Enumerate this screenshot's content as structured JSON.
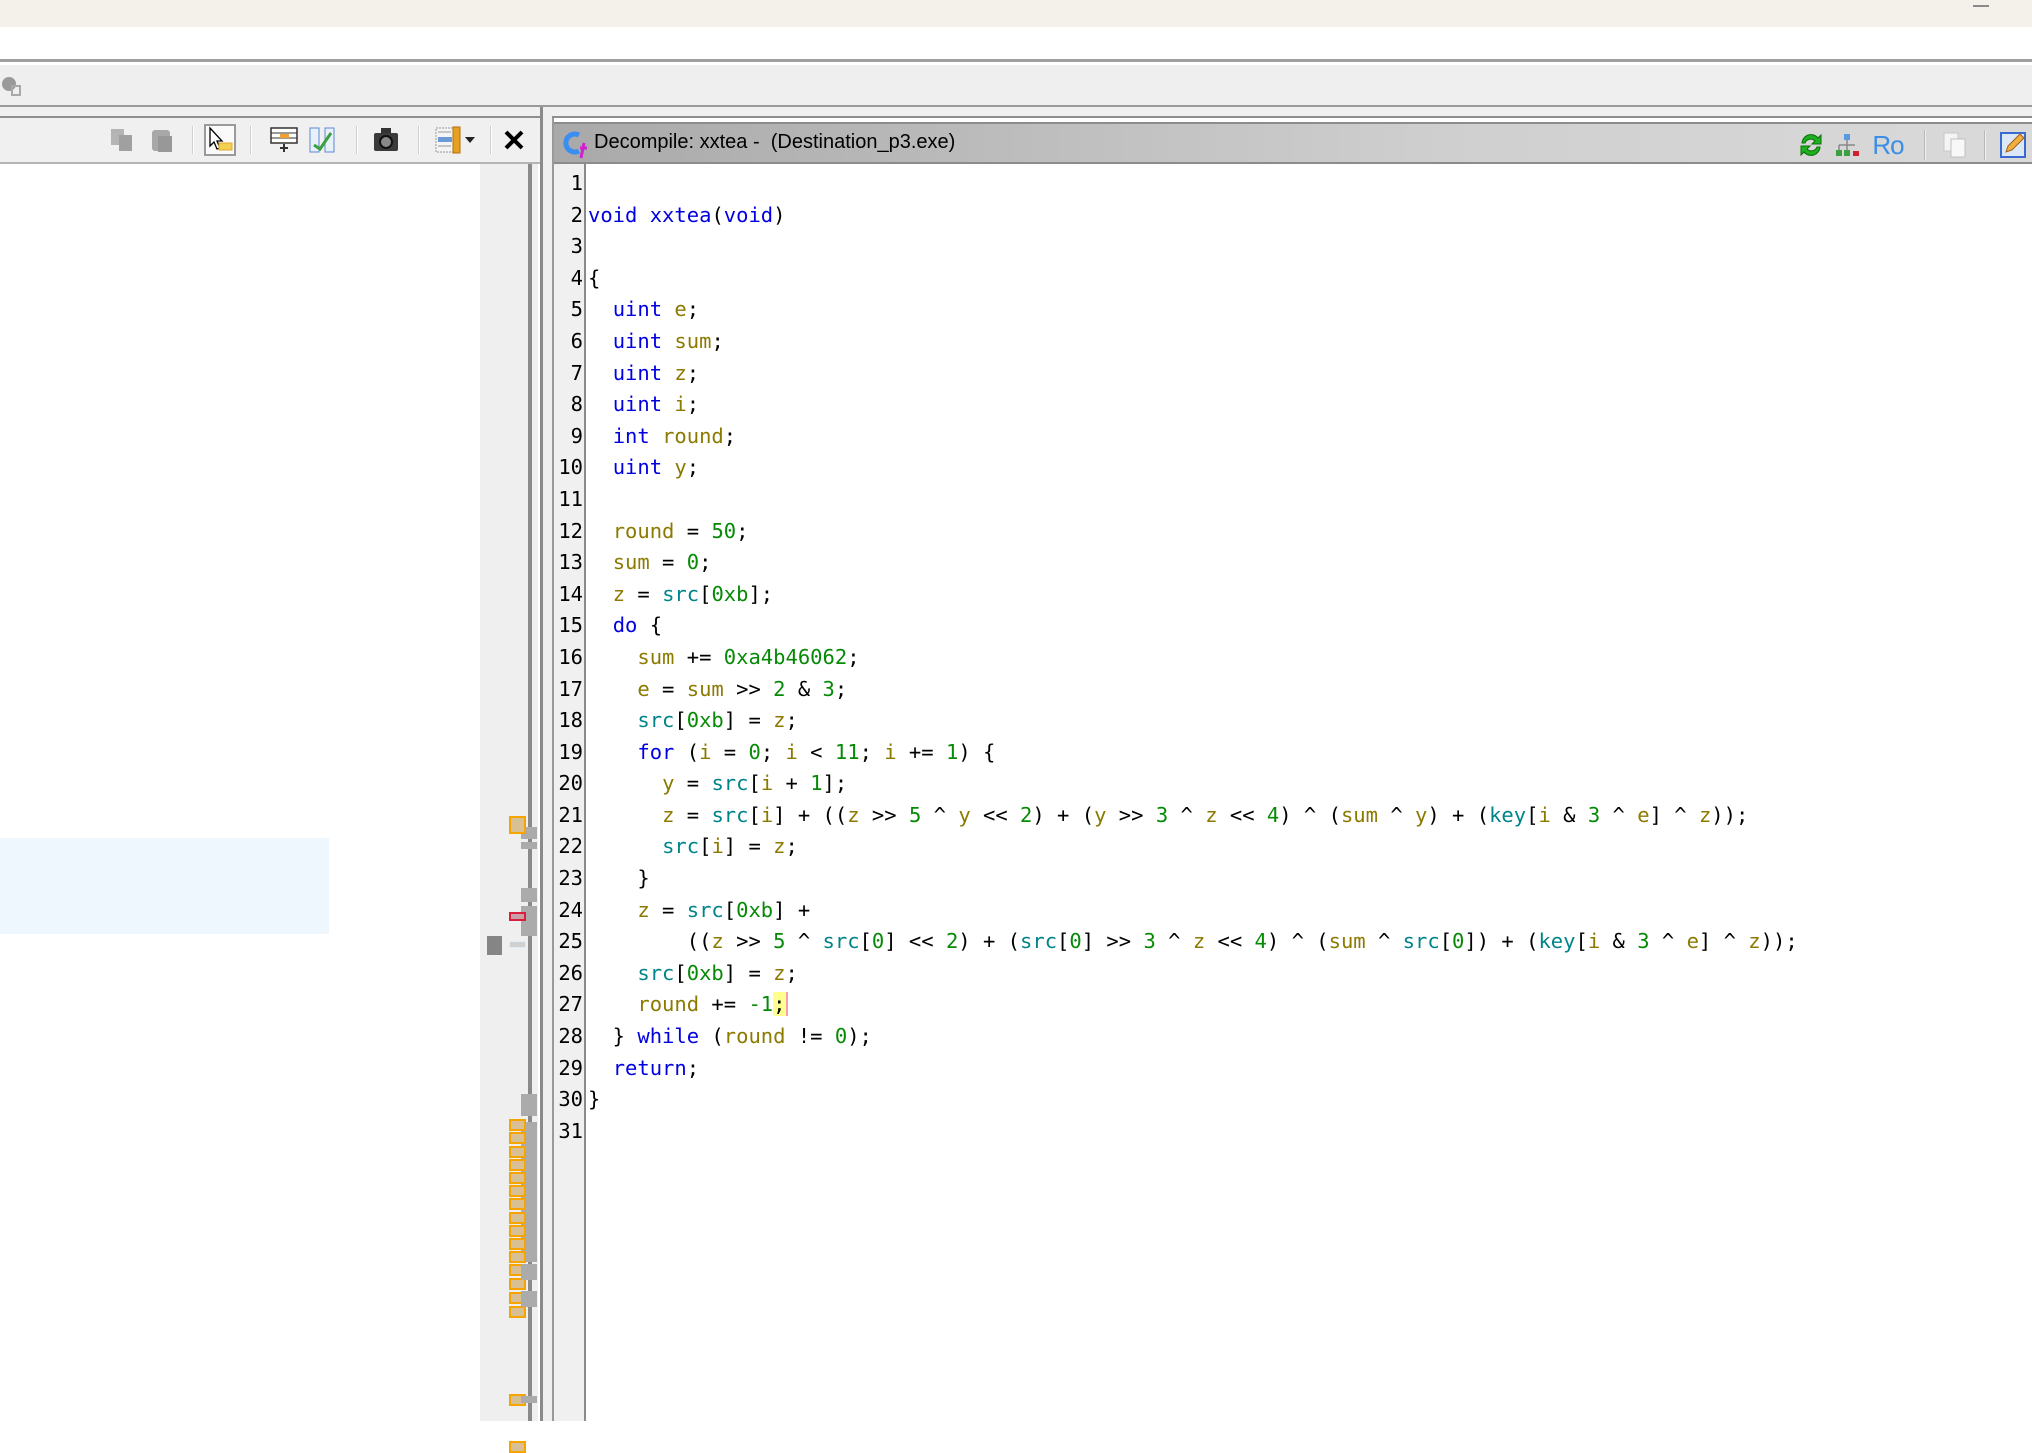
{
  "window": {
    "minimize_label": "minimize"
  },
  "left_panel": {
    "toolbar_buttons": [
      {
        "name": "copy",
        "icon": "copy-icon",
        "enabled": false
      },
      {
        "name": "paste",
        "icon": "paste-icon",
        "enabled": false
      },
      {
        "name": "cursor-text-select",
        "icon": "cursor-select-icon",
        "selected": true
      },
      {
        "name": "insert-row",
        "icon": "insert-table-icon"
      },
      {
        "name": "diff-check",
        "icon": "diff-check-icon"
      },
      {
        "name": "snapshot",
        "icon": "camera-icon"
      },
      {
        "name": "field-options",
        "icon": "listing-fields-icon",
        "has_dropdown": true
      },
      {
        "name": "close",
        "icon": "close-icon"
      }
    ]
  },
  "decompiler": {
    "title": "Decompile: xxtea -  (Destination_p3.exe)",
    "header_buttons": [
      {
        "name": "refresh",
        "icon": "refresh-icon"
      },
      {
        "name": "graph",
        "icon": "function-graph-icon"
      },
      {
        "name": "read-only",
        "icon": "ro-icon",
        "label": "Ro"
      },
      {
        "name": "copy",
        "icon": "copy-icon",
        "enabled": false
      },
      {
        "name": "edit",
        "icon": "edit-pencil-icon"
      }
    ],
    "lines": [
      {
        "n": "1",
        "tokens": []
      },
      {
        "n": "2",
        "tokens": [
          [
            "kw",
            "void"
          ],
          [
            "op",
            " "
          ],
          [
            "fn",
            "xxtea"
          ],
          [
            "op",
            "("
          ],
          [
            "kw",
            "void"
          ],
          [
            "op",
            ")"
          ]
        ]
      },
      {
        "n": "3",
        "tokens": []
      },
      {
        "n": "4",
        "tokens": [
          [
            "op",
            "{"
          ]
        ]
      },
      {
        "n": "5",
        "tokens": [
          [
            "op",
            "  "
          ],
          [
            "kw",
            "uint"
          ],
          [
            "op",
            " "
          ],
          [
            "var",
            "e"
          ],
          [
            "op",
            ";"
          ]
        ]
      },
      {
        "n": "6",
        "tokens": [
          [
            "op",
            "  "
          ],
          [
            "kw",
            "uint"
          ],
          [
            "op",
            " "
          ],
          [
            "var",
            "sum"
          ],
          [
            "op",
            ";"
          ]
        ]
      },
      {
        "n": "7",
        "tokens": [
          [
            "op",
            "  "
          ],
          [
            "kw",
            "uint"
          ],
          [
            "op",
            " "
          ],
          [
            "var",
            "z"
          ],
          [
            "op",
            ";"
          ]
        ]
      },
      {
        "n": "8",
        "tokens": [
          [
            "op",
            "  "
          ],
          [
            "kw",
            "uint"
          ],
          [
            "op",
            " "
          ],
          [
            "var",
            "i"
          ],
          [
            "op",
            ";"
          ]
        ]
      },
      {
        "n": "9",
        "tokens": [
          [
            "op",
            "  "
          ],
          [
            "kw",
            "int"
          ],
          [
            "op",
            " "
          ],
          [
            "var",
            "round"
          ],
          [
            "op",
            ";"
          ]
        ]
      },
      {
        "n": "10",
        "tokens": [
          [
            "op",
            "  "
          ],
          [
            "kw",
            "uint"
          ],
          [
            "op",
            " "
          ],
          [
            "var",
            "y"
          ],
          [
            "op",
            ";"
          ]
        ]
      },
      {
        "n": "11",
        "tokens": []
      },
      {
        "n": "12",
        "tokens": [
          [
            "op",
            "  "
          ],
          [
            "var",
            "round"
          ],
          [
            "op",
            " = "
          ],
          [
            "num",
            "50"
          ],
          [
            "op",
            ";"
          ]
        ]
      },
      {
        "n": "13",
        "tokens": [
          [
            "op",
            "  "
          ],
          [
            "var",
            "sum"
          ],
          [
            "op",
            " = "
          ],
          [
            "num",
            "0"
          ],
          [
            "op",
            ";"
          ]
        ]
      },
      {
        "n": "14",
        "tokens": [
          [
            "op",
            "  "
          ],
          [
            "var",
            "z"
          ],
          [
            "op",
            " = "
          ],
          [
            "glob",
            "src"
          ],
          [
            "op",
            "["
          ],
          [
            "num",
            "0xb"
          ],
          [
            "op",
            "];"
          ]
        ]
      },
      {
        "n": "15",
        "tokens": [
          [
            "op",
            "  "
          ],
          [
            "kw",
            "do"
          ],
          [
            "op",
            " {"
          ]
        ]
      },
      {
        "n": "16",
        "tokens": [
          [
            "op",
            "    "
          ],
          [
            "var",
            "sum"
          ],
          [
            "op",
            " += "
          ],
          [
            "num",
            "0xa4b46062"
          ],
          [
            "op",
            ";"
          ]
        ]
      },
      {
        "n": "17",
        "tokens": [
          [
            "op",
            "    "
          ],
          [
            "var",
            "e"
          ],
          [
            "op",
            " = "
          ],
          [
            "var",
            "sum"
          ],
          [
            "op",
            " >> "
          ],
          [
            "num",
            "2"
          ],
          [
            "op",
            " & "
          ],
          [
            "num",
            "3"
          ],
          [
            "op",
            ";"
          ]
        ]
      },
      {
        "n": "18",
        "tokens": [
          [
            "op",
            "    "
          ],
          [
            "glob",
            "src"
          ],
          [
            "op",
            "["
          ],
          [
            "num",
            "0xb"
          ],
          [
            "op",
            "] = "
          ],
          [
            "var",
            "z"
          ],
          [
            "op",
            ";"
          ]
        ]
      },
      {
        "n": "19",
        "tokens": [
          [
            "op",
            "    "
          ],
          [
            "kw",
            "for"
          ],
          [
            "op",
            " ("
          ],
          [
            "var",
            "i"
          ],
          [
            "op",
            " = "
          ],
          [
            "num",
            "0"
          ],
          [
            "op",
            "; "
          ],
          [
            "var",
            "i"
          ],
          [
            "op",
            " < "
          ],
          [
            "num",
            "11"
          ],
          [
            "op",
            "; "
          ],
          [
            "var",
            "i"
          ],
          [
            "op",
            " += "
          ],
          [
            "num",
            "1"
          ],
          [
            "op",
            ") {"
          ]
        ]
      },
      {
        "n": "20",
        "tokens": [
          [
            "op",
            "      "
          ],
          [
            "var",
            "y"
          ],
          [
            "op",
            " = "
          ],
          [
            "glob",
            "src"
          ],
          [
            "op",
            "["
          ],
          [
            "var",
            "i"
          ],
          [
            "op",
            " + "
          ],
          [
            "num",
            "1"
          ],
          [
            "op",
            "];"
          ]
        ]
      },
      {
        "n": "21",
        "tokens": [
          [
            "op",
            "      "
          ],
          [
            "var",
            "z"
          ],
          [
            "op",
            " = "
          ],
          [
            "glob",
            "src"
          ],
          [
            "op",
            "["
          ],
          [
            "var",
            "i"
          ],
          [
            "op",
            "] + (("
          ],
          [
            "var",
            "z"
          ],
          [
            "op",
            " >> "
          ],
          [
            "num",
            "5"
          ],
          [
            "op",
            " ^ "
          ],
          [
            "var",
            "y"
          ],
          [
            "op",
            " << "
          ],
          [
            "num",
            "2"
          ],
          [
            "op",
            ") + ("
          ],
          [
            "var",
            "y"
          ],
          [
            "op",
            " >> "
          ],
          [
            "num",
            "3"
          ],
          [
            "op",
            " ^ "
          ],
          [
            "var",
            "z"
          ],
          [
            "op",
            " << "
          ],
          [
            "num",
            "4"
          ],
          [
            "op",
            ") ^ ("
          ],
          [
            "var",
            "sum"
          ],
          [
            "op",
            " ^ "
          ],
          [
            "var",
            "y"
          ],
          [
            "op",
            ") + ("
          ],
          [
            "glob",
            "key"
          ],
          [
            "op",
            "["
          ],
          [
            "var",
            "i"
          ],
          [
            "op",
            " & "
          ],
          [
            "num",
            "3"
          ],
          [
            "op",
            " ^ "
          ],
          [
            "var",
            "e"
          ],
          [
            "op",
            "] ^ "
          ],
          [
            "var",
            "z"
          ],
          [
            "op",
            "));"
          ]
        ]
      },
      {
        "n": "22",
        "tokens": [
          [
            "op",
            "      "
          ],
          [
            "glob",
            "src"
          ],
          [
            "op",
            "["
          ],
          [
            "var",
            "i"
          ],
          [
            "op",
            "] = "
          ],
          [
            "var",
            "z"
          ],
          [
            "op",
            ";"
          ]
        ]
      },
      {
        "n": "23",
        "tokens": [
          [
            "op",
            "    }"
          ]
        ]
      },
      {
        "n": "24",
        "tokens": [
          [
            "op",
            "    "
          ],
          [
            "var",
            "z"
          ],
          [
            "op",
            " = "
          ],
          [
            "glob",
            "src"
          ],
          [
            "op",
            "["
          ],
          [
            "num",
            "0xb"
          ],
          [
            "op",
            "] +"
          ]
        ]
      },
      {
        "n": "25",
        "tokens": [
          [
            "op",
            "        (("
          ],
          [
            "var",
            "z"
          ],
          [
            "op",
            " >> "
          ],
          [
            "num",
            "5"
          ],
          [
            "op",
            " ^ "
          ],
          [
            "glob",
            "src"
          ],
          [
            "op",
            "["
          ],
          [
            "num",
            "0"
          ],
          [
            "op",
            "] << "
          ],
          [
            "num",
            "2"
          ],
          [
            "op",
            ") + ("
          ],
          [
            "glob",
            "src"
          ],
          [
            "op",
            "["
          ],
          [
            "num",
            "0"
          ],
          [
            "op",
            "] >> "
          ],
          [
            "num",
            "3"
          ],
          [
            "op",
            " ^ "
          ],
          [
            "var",
            "z"
          ],
          [
            "op",
            " << "
          ],
          [
            "num",
            "4"
          ],
          [
            "op",
            ") ^ ("
          ],
          [
            "var",
            "sum"
          ],
          [
            "op",
            " ^ "
          ],
          [
            "glob",
            "src"
          ],
          [
            "op",
            "["
          ],
          [
            "num",
            "0"
          ],
          [
            "op",
            "]) + ("
          ],
          [
            "glob",
            "key"
          ],
          [
            "op",
            "["
          ],
          [
            "var",
            "i"
          ],
          [
            "op",
            " & "
          ],
          [
            "num",
            "3"
          ],
          [
            "op",
            " ^ "
          ],
          [
            "var",
            "e"
          ],
          [
            "op",
            "] ^ "
          ],
          [
            "var",
            "z"
          ],
          [
            "op",
            "));"
          ]
        ]
      },
      {
        "n": "26",
        "tokens": [
          [
            "op",
            "    "
          ],
          [
            "glob",
            "src"
          ],
          [
            "op",
            "["
          ],
          [
            "num",
            "0xb"
          ],
          [
            "op",
            "] = "
          ],
          [
            "var",
            "z"
          ],
          [
            "op",
            ";"
          ]
        ]
      },
      {
        "n": "27",
        "tokens": [
          [
            "op",
            "    "
          ],
          [
            "var",
            "round"
          ],
          [
            "op",
            " += "
          ],
          [
            "num",
            "-1"
          ],
          [
            "cursor",
            ";"
          ]
        ]
      },
      {
        "n": "28",
        "tokens": [
          [
            "op",
            "  } "
          ],
          [
            "kw",
            "while"
          ],
          [
            "op",
            " ("
          ],
          [
            "var",
            "round"
          ],
          [
            "op",
            " != "
          ],
          [
            "num",
            "0"
          ],
          [
            "op",
            ");"
          ]
        ]
      },
      {
        "n": "29",
        "tokens": [
          [
            "op",
            "  "
          ],
          [
            "kw",
            "return"
          ],
          [
            "op",
            ";"
          ]
        ]
      },
      {
        "n": "30",
        "tokens": [
          [
            "op",
            "}"
          ]
        ]
      },
      {
        "n": "31",
        "tokens": []
      }
    ]
  },
  "colors": {
    "keyword": "#0000e0",
    "variable": "#8c7a00",
    "global": "#00848a",
    "number": "#068a06",
    "cursor_highlight": "#ffff90",
    "marker_orange": "#f7a400",
    "marker_red": "#d8203c"
  }
}
